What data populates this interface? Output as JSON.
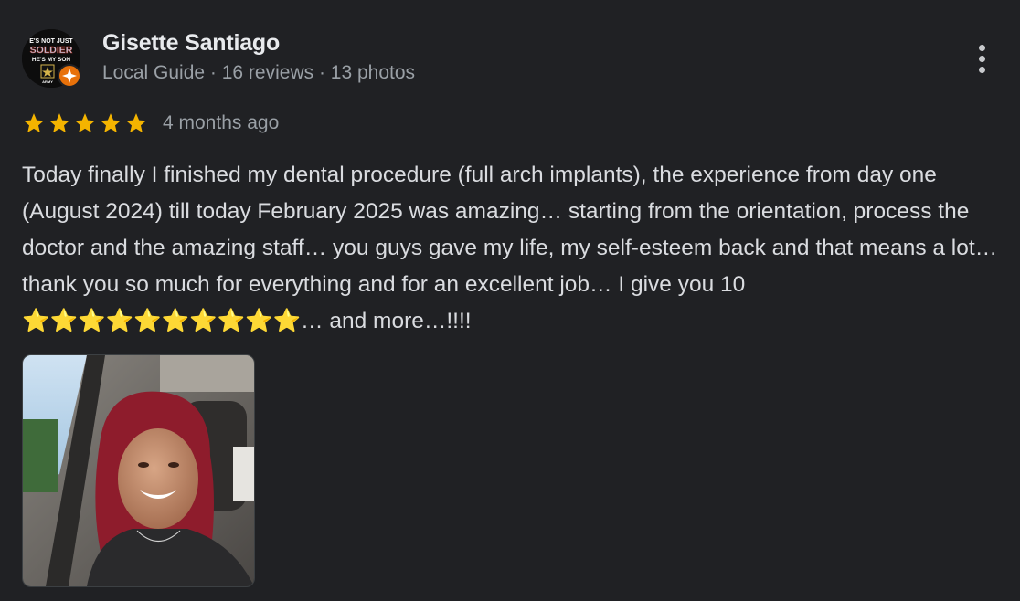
{
  "reviewer": {
    "name": "Gisette Santiago",
    "meta": "Local Guide · 16 reviews · 13 photos",
    "avatar_text": {
      "line1": "E'S NOT JUST",
      "line2": "SOLDIER",
      "line3": "HE'S MY SON",
      "line4": "ARMY"
    }
  },
  "rating": {
    "stars": 5,
    "max_stars": 5,
    "time_ago": "4 months ago"
  },
  "review": {
    "text": "Today finally I finished my dental procedure (full arch implants), the experience from day one (August 2024) till today February 2025 was amazing… starting from the orientation, process the doctor and the amazing staff… you guys gave my life, my self-esteem back and that means a lot… thank you so much for everything and for an excellent job… I give you 10 ⭐️⭐️⭐️⭐️⭐️⭐️⭐️⭐️⭐️⭐️… and more…!!!!"
  },
  "photo": {
    "subject": "selfie-in-car"
  },
  "icons": {
    "more": "more-vert-icon",
    "star": "star-icon",
    "guide_badge": "local-guide-badge-icon"
  },
  "colors": {
    "background": "#202124",
    "star": "#f4b400",
    "guide_badge": "#e8710a",
    "secondary_text": "#9aa0a6"
  }
}
